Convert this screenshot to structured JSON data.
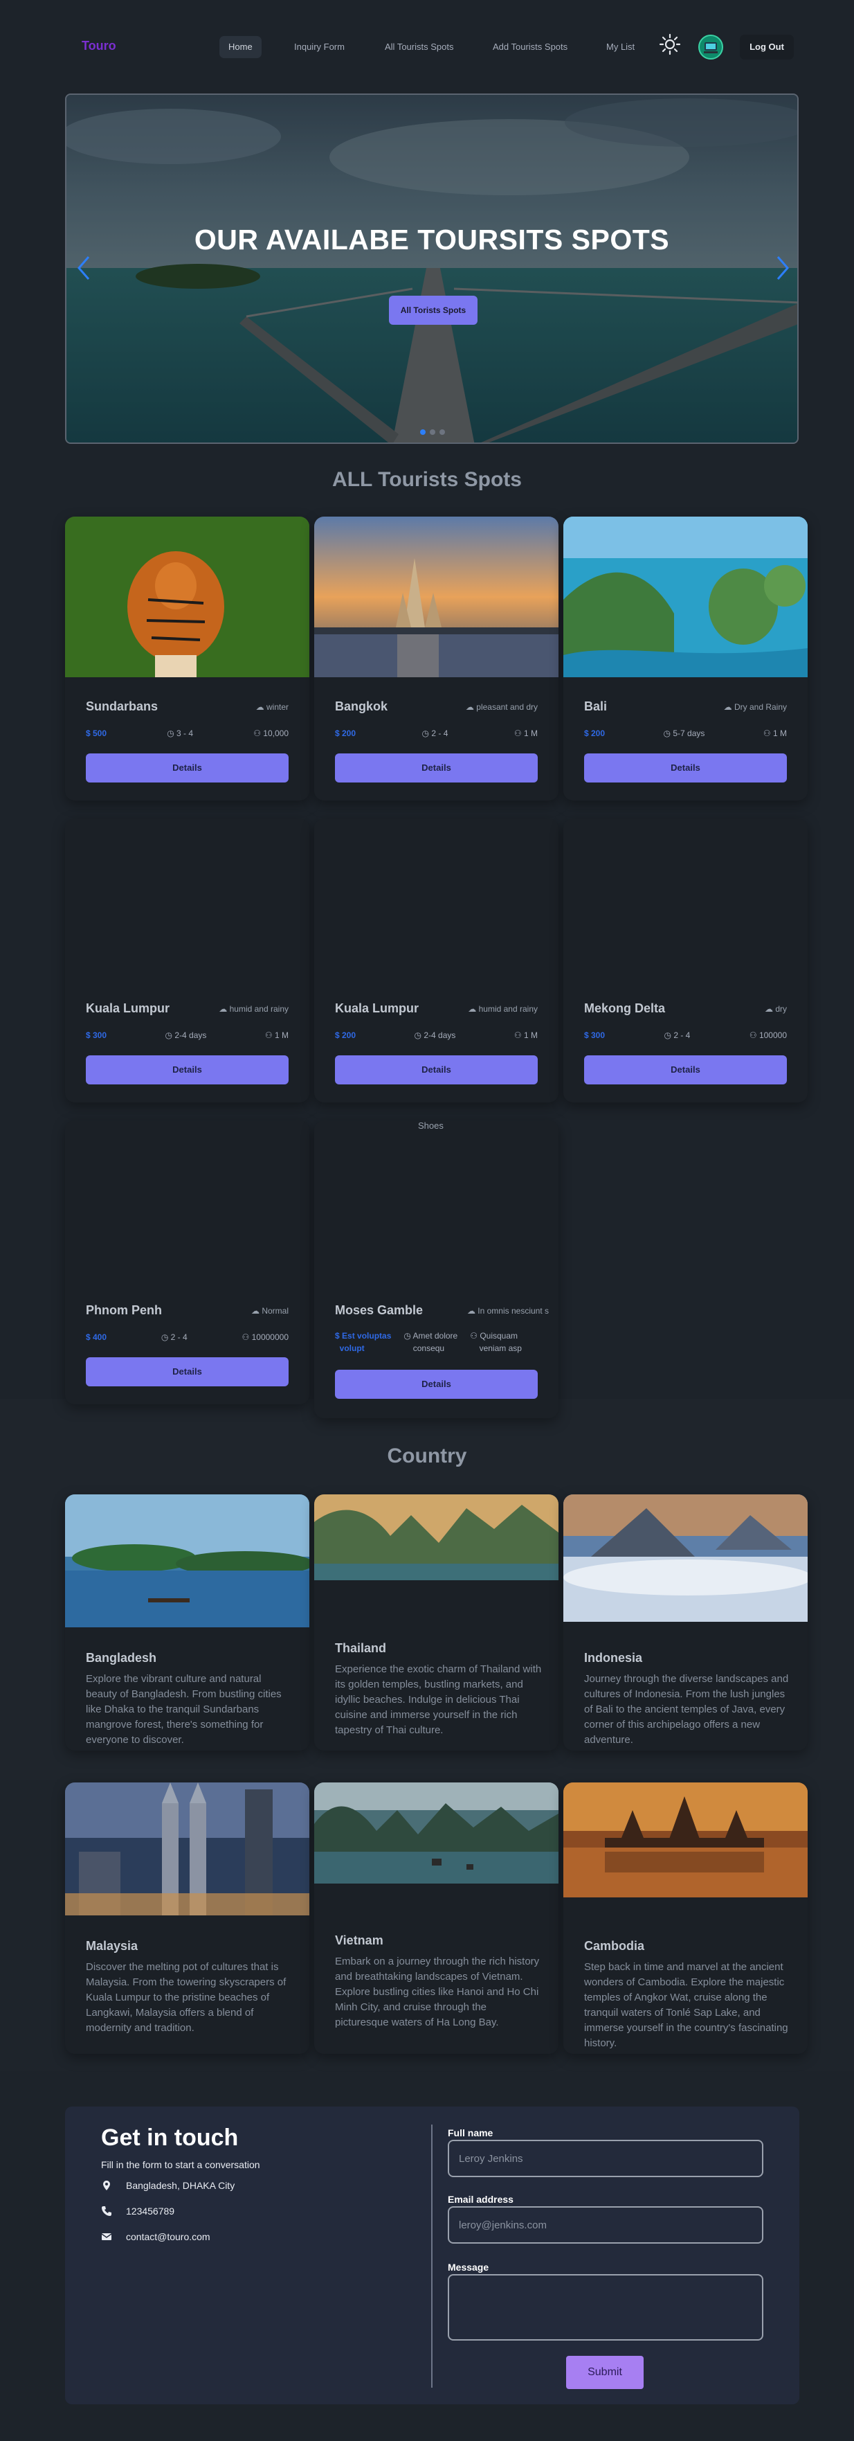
{
  "nav": {
    "logo": "Touro",
    "links": [
      "Home",
      "Inquiry Form",
      "All Tourists Spots",
      "Add Tourists Spots",
      "My List"
    ],
    "logout": "Log Out"
  },
  "banner": {
    "title": "OUR AVAILABE TOURSITS SPOTS",
    "button": "All Torists Spots"
  },
  "spots_section": {
    "title": "ALL Tourists Spots"
  },
  "spots": [
    {
      "name": "Sundarbans",
      "season": "winter",
      "cost": "$ 500",
      "time": "3 - 4",
      "visitors": "10,000",
      "button": "Details"
    },
    {
      "name": "Bangkok",
      "season": "pleasant and dry",
      "cost": "$ 200",
      "time": "2 - 4",
      "visitors": "1 M",
      "button": "Details"
    },
    {
      "name": "Bali",
      "season": "Dry and Rainy",
      "cost": "$ 200",
      "time": "5-7 days",
      "visitors": "1 M",
      "button": "Details"
    },
    {
      "name": "Kuala Lumpur",
      "season": "humid and rainy",
      "cost": "$ 300",
      "time": "2-4 days",
      "visitors": "1 M",
      "button": "Details"
    },
    {
      "name": "Kuala Lumpur",
      "season": "humid and rainy",
      "cost": "$ 200",
      "time": "2-4 days",
      "visitors": "1 M",
      "button": "Details"
    },
    {
      "name": "Mekong Delta",
      "season": "dry",
      "cost": "$ 300",
      "time": "2 - 4",
      "visitors": "100000",
      "button": "Details"
    },
    {
      "name": "Phnom Penh",
      "season": "Normal",
      "cost": "$ 400",
      "time": "2 - 4",
      "visitors": "10000000",
      "button": "Details"
    },
    {
      "name": "Moses Gamble",
      "season": "In omnis nesciunt s",
      "cost_line1": "Est voluptas",
      "cost_line2": "volupt",
      "time_line1": "Amet dolore",
      "time_line2": "consequ",
      "visitors_line1": "Quisquam",
      "visitors_line2": "veniam asp",
      "alt": "Shoes",
      "button": "Details"
    }
  ],
  "country_section": {
    "title": "Country"
  },
  "countries": [
    {
      "name": "Bangladesh",
      "desc": "Explore the vibrant culture and natural beauty of Bangladesh. From bustling cities like Dhaka to the tranquil Sundarbans mangrove forest, there's something for everyone to discover."
    },
    {
      "name": "Thailand",
      "desc": "Experience the exotic charm of Thailand with its golden temples, bustling markets, and idyllic beaches. Indulge in delicious Thai cuisine and immerse yourself in the rich tapestry of Thai culture."
    },
    {
      "name": "Indonesia",
      "desc": "Journey through the diverse landscapes and cultures of Indonesia. From the lush jungles of Bali to the ancient temples of Java, every corner of this archipelago offers a new adventure."
    },
    {
      "name": "Malaysia",
      "desc": "Discover the melting pot of cultures that is Malaysia. From the towering skyscrapers of Kuala Lumpur to the pristine beaches of Langkawi, Malaysia offers a blend of modernity and tradition."
    },
    {
      "name": "Vietnam",
      "desc": "Embark on a journey through the rich history and breathtaking landscapes of Vietnam. Explore bustling cities like Hanoi and Ho Chi Minh City, and cruise through the picturesque waters of Ha Long Bay."
    },
    {
      "name": "Cambodia",
      "desc": "Step back in time and marvel at the ancient wonders of Cambodia. Explore the majestic temples of Angkor Wat, cruise along the tranquil waters of Tonlé Sap Lake, and immerse yourself in the country's fascinating history."
    }
  ],
  "contact": {
    "title": "Get in touch",
    "subtitle": "Fill in the form to start a conversation",
    "address": "Bangladesh, DHAKA City",
    "phone": "123456789",
    "email": "contact@touro.com",
    "fullname_label": "Full name",
    "fullname_placeholder": "Leroy Jenkins",
    "email_label": "Email address",
    "email_placeholder": "leroy@jenkins.com",
    "message_label": "Message",
    "submit": "Submit"
  },
  "colors": {
    "accent": "#7a77f0",
    "cost": "#2f69e5",
    "logo": "#7b2fd1",
    "submit": "#a77ff2"
  }
}
